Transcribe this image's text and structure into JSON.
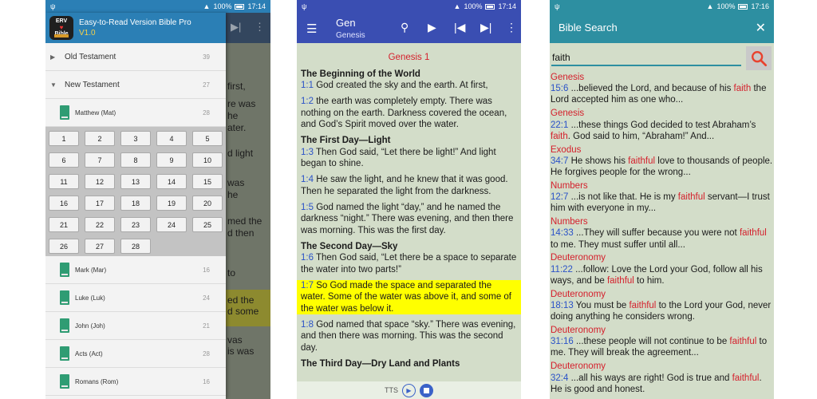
{
  "status": {
    "p1_time": "17:14",
    "p2_time": "17:14",
    "p3_time": "17:16",
    "battery": "100%"
  },
  "phone1": {
    "app_title": "Easy-to-Read Version Bible Pro",
    "version": "V1.0",
    "logo_text": [
      "ERV",
      "Bible"
    ],
    "old_testament": {
      "label": "Old Testament",
      "count": "39"
    },
    "new_testament": {
      "label": "New Testament",
      "count": "27"
    },
    "books_before": [
      {
        "label": "Matthew (Mat)",
        "count": "28"
      }
    ],
    "chapters": [
      "1",
      "2",
      "3",
      "4",
      "5",
      "6",
      "7",
      "8",
      "9",
      "10",
      "11",
      "12",
      "13",
      "14",
      "15",
      "16",
      "17",
      "18",
      "19",
      "20",
      "21",
      "22",
      "23",
      "24",
      "25",
      "26",
      "27",
      "28"
    ],
    "books_after": [
      {
        "label": "Mark (Mar)",
        "count": "16"
      },
      {
        "label": "Luke (Luk)",
        "count": "24"
      },
      {
        "label": "John (Joh)",
        "count": "21"
      },
      {
        "label": "Acts (Act)",
        "count": "28"
      },
      {
        "label": "Romans (Rom)",
        "count": "16"
      }
    ],
    "bg_fragments": [
      "first,",
      "re was",
      "he",
      "ater.",
      "d light",
      "was",
      "he",
      "med the",
      "d then",
      "to",
      "ed the",
      "d some",
      "vas",
      "is was"
    ]
  },
  "phone2": {
    "book": "Gen",
    "book_sub": "Genesis",
    "chapter_title": "Genesis 1",
    "blocks": [
      {
        "type": "heading",
        "text": "The Beginning of the World"
      },
      {
        "type": "verse",
        "ref": "1:1",
        "text": " God created the sky and the earth. At first,"
      },
      {
        "type": "verse",
        "ref": "1:2",
        "text": " the earth was completely empty. There was nothing on the earth. Darkness covered the ocean, and God’s Spirit moved over the water."
      },
      {
        "type": "heading",
        "text": "The First Day—Light"
      },
      {
        "type": "verse",
        "ref": "1:3",
        "text": " Then God said, “Let there be light!” And light began to shine."
      },
      {
        "type": "verse",
        "ref": "1:4",
        "text": " He saw the light, and he knew that it was good. Then he separated the light from the darkness."
      },
      {
        "type": "verse",
        "ref": "1:5",
        "text": " God named the light “day,” and he named the darkness “night.” There was evening, and then there was morning. This was the first day."
      },
      {
        "type": "heading",
        "text": "The Second Day—Sky"
      },
      {
        "type": "verse",
        "ref": "1:6",
        "text": " Then God said, “Let there be a space to separate the water into two parts!”"
      },
      {
        "type": "verse",
        "ref": "1:7",
        "text": " So God made the space and separated the water. Some of the water was above it, and some of the water was below it.",
        "highlight": true
      },
      {
        "type": "verse",
        "ref": "1:8",
        "text": " God named that space “sky.” There was evening, and then there was morning. This was the second day."
      },
      {
        "type": "heading",
        "text": "The Third Day—Dry Land and Plants"
      }
    ],
    "tts_label": "TTS"
  },
  "phone3": {
    "title": "Bible Search",
    "query": "faith",
    "results": [
      {
        "book": "Genesis",
        "ref": "15:6",
        "parts": [
          " ...believed the Lord, and because of his ",
          "faith",
          " the Lord accepted him as one who..."
        ]
      },
      {
        "book": "Genesis",
        "ref": "22:1",
        "parts": [
          " ...these things God decided to test Abraham’s ",
          "faith",
          ". God said to him, “Abraham!” And..."
        ]
      },
      {
        "book": "Exodus",
        "ref": "34:7",
        "parts": [
          " He shows his ",
          "faithful",
          " love to thousands of people. He forgives people for the wrong..."
        ]
      },
      {
        "book": "Numbers",
        "ref": "12:7",
        "parts": [
          " ...is not like that. He is my ",
          "faithful",
          " servant—I trust him with everyone in my..."
        ]
      },
      {
        "book": "Numbers",
        "ref": "14:33",
        "parts": [
          " ...They will suffer because you were not ",
          "faithful",
          " to me. They must suffer until all..."
        ]
      },
      {
        "book": "Deuteronomy",
        "ref": "11:22",
        "parts": [
          " ...follow: Love the Lord your God, follow all his ways, and be ",
          "faithful",
          " to him."
        ]
      },
      {
        "book": "Deuteronomy",
        "ref": "18:13",
        "parts": [
          " You must be ",
          "faithful",
          " to the Lord your God, never doing anything he considers wrong."
        ]
      },
      {
        "book": "Deuteronomy",
        "ref": "31:16",
        "parts": [
          " ...these people will not continue to be ",
          "faithful",
          " to me. They will break the agreement..."
        ]
      },
      {
        "book": "Deuteronomy",
        "ref": "32:4",
        "parts": [
          " ...all his ways are right! God is true and ",
          "faithful",
          ". He is good and honest."
        ]
      }
    ]
  }
}
